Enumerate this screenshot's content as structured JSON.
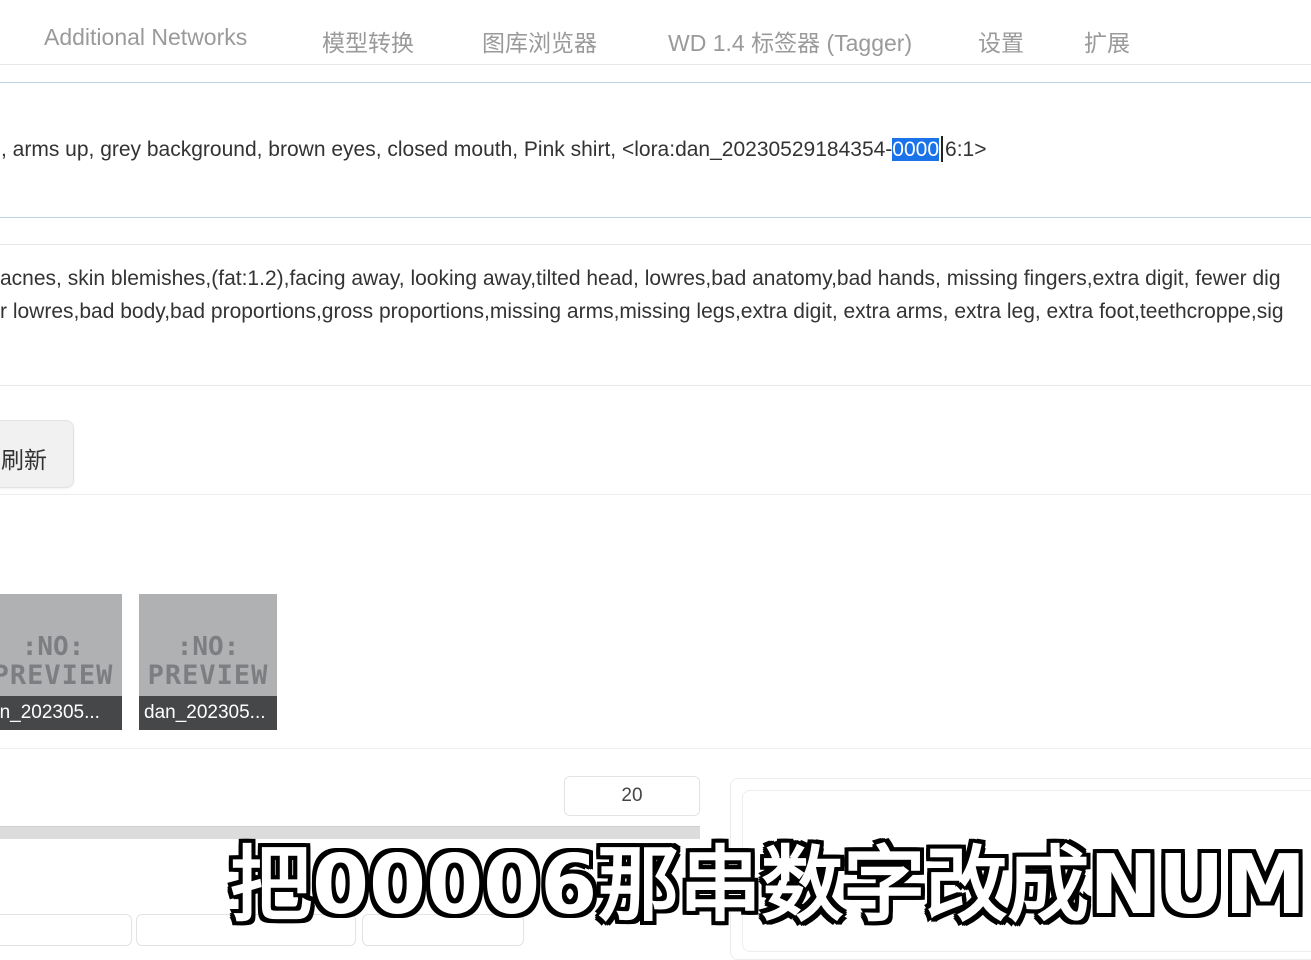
{
  "tabs": [
    {
      "label": "Additional Networks"
    },
    {
      "label": "模型转换"
    },
    {
      "label": "图库浏览器"
    },
    {
      "label": "WD 1.4 标签器 (Tagger)"
    },
    {
      "label": "设置"
    },
    {
      "label": "扩展"
    }
  ],
  "prompt": {
    "before_selection": ", arms up, grey background, brown eyes, closed mouth, Pink shirt, <lora:dan_20230529184354-",
    "selection": "0000",
    "after_selection": "6:1>"
  },
  "negative_prompt": {
    "line1": "acnes, skin blemishes,(fat:1.2),facing away, looking away,tilted head, lowres,bad anatomy,bad hands, missing fingers,extra digit, fewer dig",
    "line2": "r lowres,bad body,bad proportions,gross proportions,missing arms,missing legs,extra digit, extra arms, extra leg, extra foot,teethcroppe,sig"
  },
  "refresh_button": {
    "label": "刷新"
  },
  "lora_cards": [
    {
      "preview_line1": ":NO:",
      "preview_line2": "PREVIEW",
      "caption": "an_202305..."
    },
    {
      "preview_line1": ":NO:",
      "preview_line2": "PREVIEW",
      "caption": "dan_202305..."
    }
  ],
  "number_field": {
    "value": "20"
  },
  "subtitle": {
    "text": "把00006那串数字改成NUM"
  }
}
